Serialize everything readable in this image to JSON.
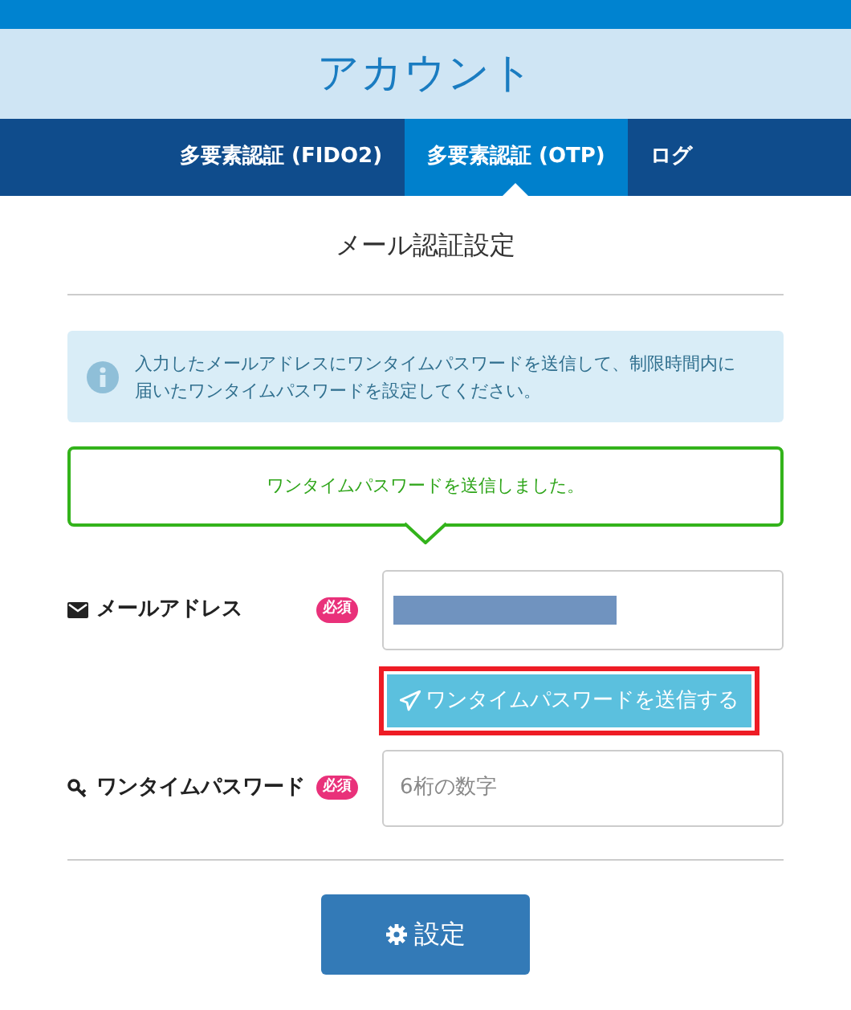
{
  "header": {
    "title": "アカウント"
  },
  "tabs": [
    {
      "label": "多要素認証 (FIDO2)",
      "selected": false
    },
    {
      "label": "多要素認証 (OTP)",
      "selected": true
    },
    {
      "label": "ログ",
      "selected": false
    }
  ],
  "section_title": "メール認証設定",
  "info_message": "入力したメールアドレスにワンタイムパスワードを送信して、制限時間内に届いたワンタイムパスワードを設定してください。",
  "popover": "ワンタイムパスワードを送信しました。",
  "email": {
    "label": "メールアドレス",
    "badge": "必須",
    "redacted": true
  },
  "send_button": {
    "label": "ワンタイムパスワードを送信する",
    "highlighted": true
  },
  "otp": {
    "label": "ワンタイムパスワード",
    "badge": "必須",
    "placeholder": "6桁の数字"
  },
  "submit_button": "設定"
}
